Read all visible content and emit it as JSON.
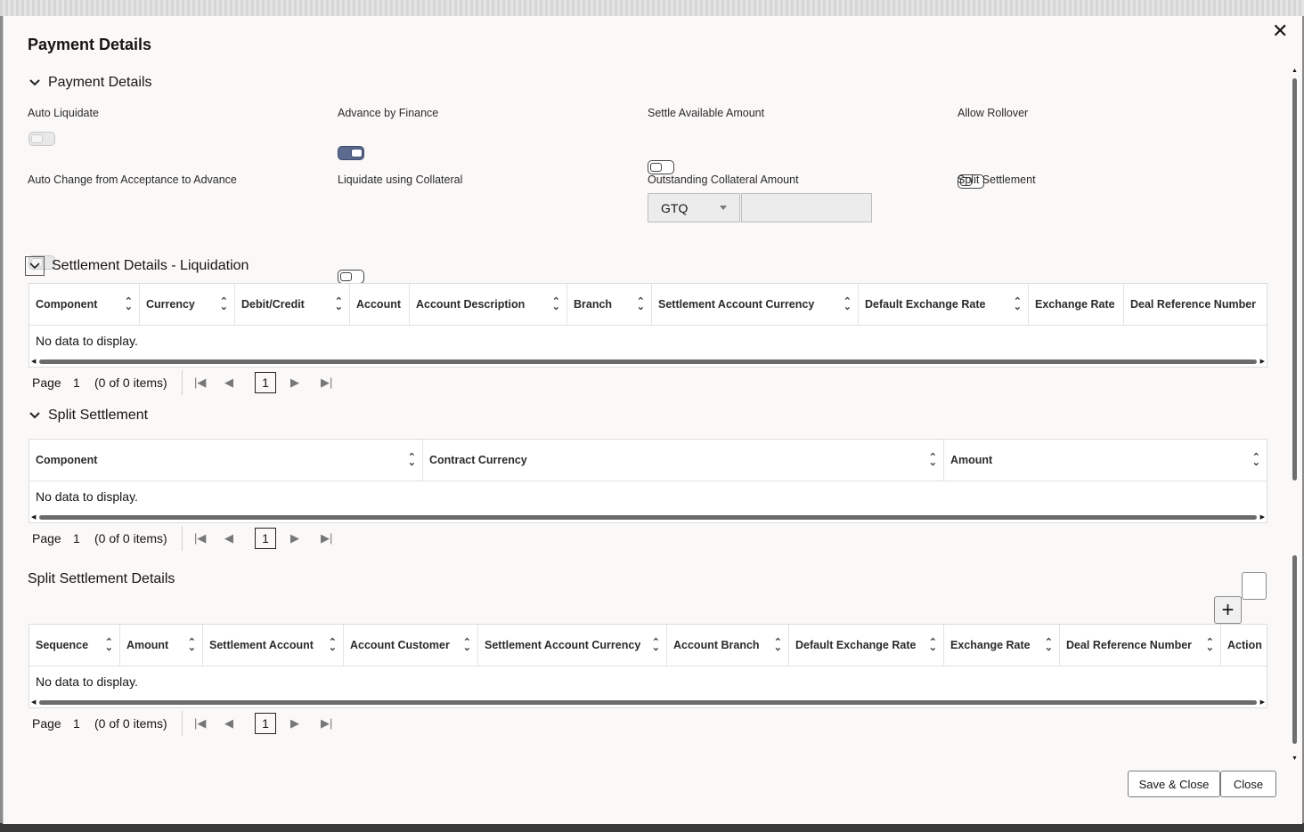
{
  "dialog": {
    "title": "Payment Details",
    "close_icon": "close-icon"
  },
  "payment_details": {
    "heading": "Payment Details",
    "fields": {
      "auto_liquidate": {
        "label": "Auto Liquidate",
        "state": "disabled-off"
      },
      "advance_by_finance": {
        "label": "Advance by Finance",
        "state": "on"
      },
      "settle_available_amount": {
        "label": "Settle Available Amount",
        "state": "off"
      },
      "allow_rollover": {
        "label": "Allow Rollover",
        "state": "off"
      },
      "auto_change": {
        "label": "Auto Change from Acceptance to Advance",
        "state": "disabled-off"
      },
      "liquidate_collateral": {
        "label": "Liquidate using Collateral",
        "state": "off"
      },
      "outstanding_collateral": {
        "label": "Outstanding Collateral Amount",
        "currency": "GTQ",
        "amount": ""
      },
      "split_settlement": {
        "label": "Split Settlement",
        "state": "on"
      }
    }
  },
  "liquidation": {
    "heading": "Settlement Details - Liquidation",
    "columns": [
      "Component",
      "Currency",
      "Debit/Credit",
      "Account",
      "Account Description",
      "Branch",
      "Settlement Account Currency",
      "Default Exchange Rate",
      "Exchange Rate",
      "Deal Reference Number"
    ],
    "empty": "No data to display.",
    "pager": {
      "page_label": "Page",
      "page": "1",
      "count": "(0 of 0 items)",
      "current": "1"
    }
  },
  "split_settlement": {
    "heading": "Split Settlement",
    "columns": [
      "Component",
      "Contract Currency",
      "Amount"
    ],
    "empty": "No data to display.",
    "pager": {
      "page_label": "Page",
      "page": "1",
      "count": "(0 of 0 items)",
      "current": "1"
    }
  },
  "split_details": {
    "heading": "Split Settlement Details",
    "add_symbol": "+",
    "columns": [
      "Sequence",
      "Amount",
      "Settlement Account",
      "Account Customer",
      "Settlement Account Currency",
      "Account Branch",
      "Default Exchange Rate",
      "Exchange Rate",
      "Deal Reference Number",
      "Action"
    ],
    "empty": "No data to display.",
    "pager": {
      "page_label": "Page",
      "page": "1",
      "count": "(0 of 0 items)",
      "current": "1"
    }
  },
  "footer": {
    "save_close": "Save & Close",
    "close": "Close"
  },
  "colors": {
    "toggle_on": "#5b6a8e",
    "background": "#fbf9f8"
  }
}
